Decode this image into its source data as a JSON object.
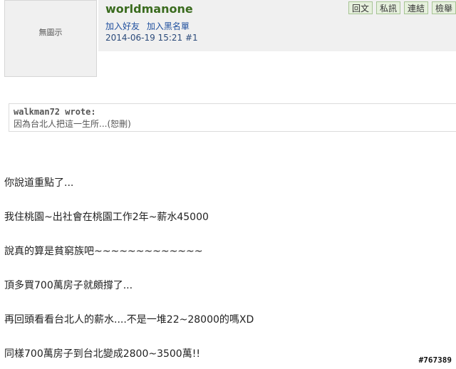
{
  "avatar": {
    "placeholder": "無圖示"
  },
  "user": {
    "name": "worldmanone",
    "add_friend": "加入好友",
    "add_blacklist": "加入黑名單"
  },
  "post": {
    "datetime": "2014-06-19 15:21",
    "floor": "#1"
  },
  "toolbar": {
    "reply": "回文",
    "private_message": "私訊",
    "link": "連結",
    "report": "檢舉"
  },
  "quote": {
    "author": "walkman72 wrote:",
    "text": "因為台北人把這一生所...(恕刪)"
  },
  "body_lines": [
    "你說道重點了...",
    "我住桃園~出社會在桃園工作2年~薪水45000",
    "說真的算是貧窮族吧~~~~~~~~~~~~~",
    "頂多買700萬房子就頗撐了...",
    "再回頭看看台北人的薪水....不是一堆22~28000的嗎XD",
    "同樣700萬房子到台北變成2800~3500萬!!"
  ],
  "watermark": "#767389"
}
